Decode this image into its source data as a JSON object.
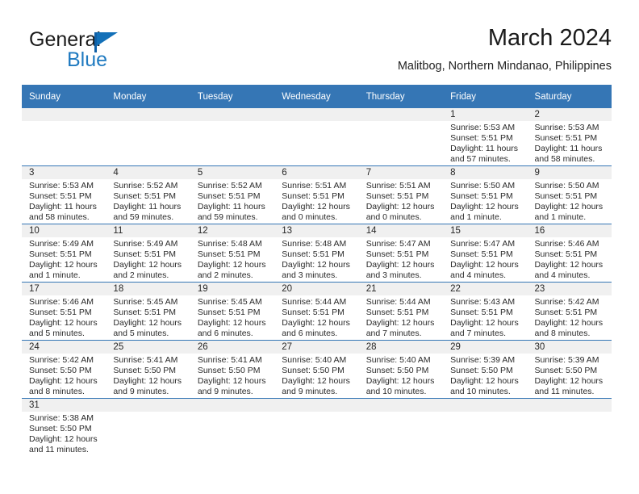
{
  "brand": {
    "name_part1": "General",
    "name_part2": "Blue",
    "flag_icon": "triangle-flag-icon",
    "color_primary": "#1f7ac0",
    "color_dark": "#1b1b1b"
  },
  "header": {
    "title": "March 2024",
    "subtitle": "Malitbog, Northern Mindanao, Philippines"
  },
  "theme": {
    "header_blue": "#3576b5",
    "row_divider_blue": "#3576b5",
    "daynum_band": "#f0f0f0",
    "text": "#2a2a2a"
  },
  "weekdays": [
    "Sunday",
    "Monday",
    "Tuesday",
    "Wednesday",
    "Thursday",
    "Friday",
    "Saturday"
  ],
  "weeks": [
    [
      {
        "day": "",
        "sunrise": "",
        "sunset": "",
        "daylight_line1": "",
        "daylight_line2": "",
        "empty": true
      },
      {
        "day": "",
        "sunrise": "",
        "sunset": "",
        "daylight_line1": "",
        "daylight_line2": "",
        "empty": true
      },
      {
        "day": "",
        "sunrise": "",
        "sunset": "",
        "daylight_line1": "",
        "daylight_line2": "",
        "empty": true
      },
      {
        "day": "",
        "sunrise": "",
        "sunset": "",
        "daylight_line1": "",
        "daylight_line2": "",
        "empty": true
      },
      {
        "day": "",
        "sunrise": "",
        "sunset": "",
        "daylight_line1": "",
        "daylight_line2": "",
        "empty": true
      },
      {
        "day": "1",
        "sunrise": "Sunrise: 5:53 AM",
        "sunset": "Sunset: 5:51 PM",
        "daylight_line1": "Daylight: 11 hours",
        "daylight_line2": "and 57 minutes."
      },
      {
        "day": "2",
        "sunrise": "Sunrise: 5:53 AM",
        "sunset": "Sunset: 5:51 PM",
        "daylight_line1": "Daylight: 11 hours",
        "daylight_line2": "and 58 minutes."
      }
    ],
    [
      {
        "day": "3",
        "sunrise": "Sunrise: 5:53 AM",
        "sunset": "Sunset: 5:51 PM",
        "daylight_line1": "Daylight: 11 hours",
        "daylight_line2": "and 58 minutes."
      },
      {
        "day": "4",
        "sunrise": "Sunrise: 5:52 AM",
        "sunset": "Sunset: 5:51 PM",
        "daylight_line1": "Daylight: 11 hours",
        "daylight_line2": "and 59 minutes."
      },
      {
        "day": "5",
        "sunrise": "Sunrise: 5:52 AM",
        "sunset": "Sunset: 5:51 PM",
        "daylight_line1": "Daylight: 11 hours",
        "daylight_line2": "and 59 minutes."
      },
      {
        "day": "6",
        "sunrise": "Sunrise: 5:51 AM",
        "sunset": "Sunset: 5:51 PM",
        "daylight_line1": "Daylight: 12 hours",
        "daylight_line2": "and 0 minutes."
      },
      {
        "day": "7",
        "sunrise": "Sunrise: 5:51 AM",
        "sunset": "Sunset: 5:51 PM",
        "daylight_line1": "Daylight: 12 hours",
        "daylight_line2": "and 0 minutes."
      },
      {
        "day": "8",
        "sunrise": "Sunrise: 5:50 AM",
        "sunset": "Sunset: 5:51 PM",
        "daylight_line1": "Daylight: 12 hours",
        "daylight_line2": "and 1 minute."
      },
      {
        "day": "9",
        "sunrise": "Sunrise: 5:50 AM",
        "sunset": "Sunset: 5:51 PM",
        "daylight_line1": "Daylight: 12 hours",
        "daylight_line2": "and 1 minute."
      }
    ],
    [
      {
        "day": "10",
        "sunrise": "Sunrise: 5:49 AM",
        "sunset": "Sunset: 5:51 PM",
        "daylight_line1": "Daylight: 12 hours",
        "daylight_line2": "and 1 minute."
      },
      {
        "day": "11",
        "sunrise": "Sunrise: 5:49 AM",
        "sunset": "Sunset: 5:51 PM",
        "daylight_line1": "Daylight: 12 hours",
        "daylight_line2": "and 2 minutes."
      },
      {
        "day": "12",
        "sunrise": "Sunrise: 5:48 AM",
        "sunset": "Sunset: 5:51 PM",
        "daylight_line1": "Daylight: 12 hours",
        "daylight_line2": "and 2 minutes."
      },
      {
        "day": "13",
        "sunrise": "Sunrise: 5:48 AM",
        "sunset": "Sunset: 5:51 PM",
        "daylight_line1": "Daylight: 12 hours",
        "daylight_line2": "and 3 minutes."
      },
      {
        "day": "14",
        "sunrise": "Sunrise: 5:47 AM",
        "sunset": "Sunset: 5:51 PM",
        "daylight_line1": "Daylight: 12 hours",
        "daylight_line2": "and 3 minutes."
      },
      {
        "day": "15",
        "sunrise": "Sunrise: 5:47 AM",
        "sunset": "Sunset: 5:51 PM",
        "daylight_line1": "Daylight: 12 hours",
        "daylight_line2": "and 4 minutes."
      },
      {
        "day": "16",
        "sunrise": "Sunrise: 5:46 AM",
        "sunset": "Sunset: 5:51 PM",
        "daylight_line1": "Daylight: 12 hours",
        "daylight_line2": "and 4 minutes."
      }
    ],
    [
      {
        "day": "17",
        "sunrise": "Sunrise: 5:46 AM",
        "sunset": "Sunset: 5:51 PM",
        "daylight_line1": "Daylight: 12 hours",
        "daylight_line2": "and 5 minutes."
      },
      {
        "day": "18",
        "sunrise": "Sunrise: 5:45 AM",
        "sunset": "Sunset: 5:51 PM",
        "daylight_line1": "Daylight: 12 hours",
        "daylight_line2": "and 5 minutes."
      },
      {
        "day": "19",
        "sunrise": "Sunrise: 5:45 AM",
        "sunset": "Sunset: 5:51 PM",
        "daylight_line1": "Daylight: 12 hours",
        "daylight_line2": "and 6 minutes."
      },
      {
        "day": "20",
        "sunrise": "Sunrise: 5:44 AM",
        "sunset": "Sunset: 5:51 PM",
        "daylight_line1": "Daylight: 12 hours",
        "daylight_line2": "and 6 minutes."
      },
      {
        "day": "21",
        "sunrise": "Sunrise: 5:44 AM",
        "sunset": "Sunset: 5:51 PM",
        "daylight_line1": "Daylight: 12 hours",
        "daylight_line2": "and 7 minutes."
      },
      {
        "day": "22",
        "sunrise": "Sunrise: 5:43 AM",
        "sunset": "Sunset: 5:51 PM",
        "daylight_line1": "Daylight: 12 hours",
        "daylight_line2": "and 7 minutes."
      },
      {
        "day": "23",
        "sunrise": "Sunrise: 5:42 AM",
        "sunset": "Sunset: 5:51 PM",
        "daylight_line1": "Daylight: 12 hours",
        "daylight_line2": "and 8 minutes."
      }
    ],
    [
      {
        "day": "24",
        "sunrise": "Sunrise: 5:42 AM",
        "sunset": "Sunset: 5:50 PM",
        "daylight_line1": "Daylight: 12 hours",
        "daylight_line2": "and 8 minutes."
      },
      {
        "day": "25",
        "sunrise": "Sunrise: 5:41 AM",
        "sunset": "Sunset: 5:50 PM",
        "daylight_line1": "Daylight: 12 hours",
        "daylight_line2": "and 9 minutes."
      },
      {
        "day": "26",
        "sunrise": "Sunrise: 5:41 AM",
        "sunset": "Sunset: 5:50 PM",
        "daylight_line1": "Daylight: 12 hours",
        "daylight_line2": "and 9 minutes."
      },
      {
        "day": "27",
        "sunrise": "Sunrise: 5:40 AM",
        "sunset": "Sunset: 5:50 PM",
        "daylight_line1": "Daylight: 12 hours",
        "daylight_line2": "and 9 minutes."
      },
      {
        "day": "28",
        "sunrise": "Sunrise: 5:40 AM",
        "sunset": "Sunset: 5:50 PM",
        "daylight_line1": "Daylight: 12 hours",
        "daylight_line2": "and 10 minutes."
      },
      {
        "day": "29",
        "sunrise": "Sunrise: 5:39 AM",
        "sunset": "Sunset: 5:50 PM",
        "daylight_line1": "Daylight: 12 hours",
        "daylight_line2": "and 10 minutes."
      },
      {
        "day": "30",
        "sunrise": "Sunrise: 5:39 AM",
        "sunset": "Sunset: 5:50 PM",
        "daylight_line1": "Daylight: 12 hours",
        "daylight_line2": "and 11 minutes."
      }
    ],
    [
      {
        "day": "31",
        "sunrise": "Sunrise: 5:38 AM",
        "sunset": "Sunset: 5:50 PM",
        "daylight_line1": "Daylight: 12 hours",
        "daylight_line2": "and 11 minutes."
      },
      {
        "day": "",
        "sunrise": "",
        "sunset": "",
        "daylight_line1": "",
        "daylight_line2": "",
        "empty": true
      },
      {
        "day": "",
        "sunrise": "",
        "sunset": "",
        "daylight_line1": "",
        "daylight_line2": "",
        "empty": true
      },
      {
        "day": "",
        "sunrise": "",
        "sunset": "",
        "daylight_line1": "",
        "daylight_line2": "",
        "empty": true
      },
      {
        "day": "",
        "sunrise": "",
        "sunset": "",
        "daylight_line1": "",
        "daylight_line2": "",
        "empty": true
      },
      {
        "day": "",
        "sunrise": "",
        "sunset": "",
        "daylight_line1": "",
        "daylight_line2": "",
        "empty": true
      },
      {
        "day": "",
        "sunrise": "",
        "sunset": "",
        "daylight_line1": "",
        "daylight_line2": "",
        "empty": true
      }
    ]
  ]
}
